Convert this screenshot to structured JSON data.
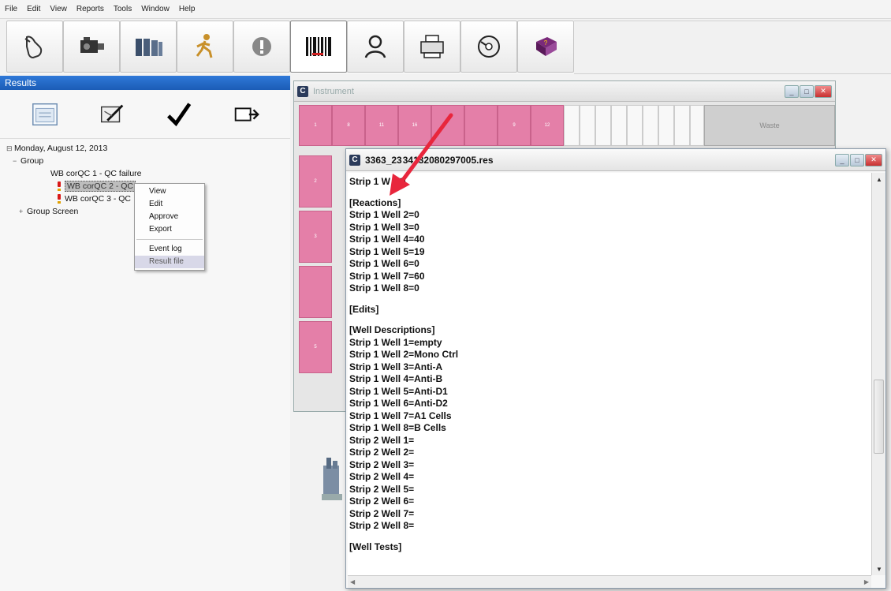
{
  "menu": [
    "File",
    "Edit",
    "View",
    "Reports",
    "Tools",
    "Window",
    "Help"
  ],
  "toolbar": {
    "icons": [
      "hand-pointer-icon",
      "camera-icon",
      "rack-icon",
      "runner-icon",
      "alert-icon",
      "barcode-icon",
      "user-search-icon",
      "printer-icon",
      "disc-icon",
      "help-book-icon"
    ]
  },
  "colors": {
    "results_header": "#1b5cb6",
    "well_pink": "#e47fa8",
    "arrow_red": "#e8263c"
  },
  "results": {
    "title": "Results",
    "tree": {
      "date": "Monday, August 12, 2013",
      "group": "Group",
      "items": [
        "WB corQC 1 - QC failure",
        "WB corQC 2 - QC",
        "WB corQC 3 - QC"
      ],
      "group_screen": "Group Screen"
    }
  },
  "context_menu": {
    "items": [
      "View",
      "Edit",
      "Approve",
      "Export"
    ],
    "items2": [
      "Event log",
      "Result file"
    ]
  },
  "instrument": {
    "title": "Instrument",
    "waste_label": "Waste",
    "top_wells": [
      "1",
      "8",
      "11",
      "16",
      "",
      "",
      "9",
      "12"
    ],
    "side_wells": [
      "2",
      "3",
      "",
      "5"
    ]
  },
  "result_window": {
    "title": "3363_23 34132080297005.res",
    "lines": [
      "Strip 1 W   =Q",
      "",
      "[Reactions]",
      "Strip 1 Well 2=0",
      "Strip 1 Well 3=0",
      "Strip 1 Well 4=40",
      "Strip 1 Well 5=19",
      "Strip 1 Well 6=0",
      "Strip 1 Well 7=60",
      "Strip 1 Well 8=0",
      "",
      "[Edits]",
      "",
      "[Well Descriptions]",
      "Strip 1 Well 1=empty",
      "Strip 1 Well 2=Mono Ctrl",
      "Strip 1 Well 3=Anti-A",
      "Strip 1 Well 4=Anti-B",
      "Strip 1 Well 5=Anti-D1",
      "Strip 1 Well 6=Anti-D2",
      "Strip 1 Well 7=A1 Cells",
      "Strip 1 Well 8=B Cells",
      "Strip 2 Well 1=",
      "Strip 2 Well 2=",
      "Strip 2 Well 3=",
      "Strip 2 Well 4=",
      "Strip 2 Well 5=",
      "Strip 2 Well 6=",
      "Strip 2 Well 7=",
      "Strip 2 Well 8=",
      "",
      "[Well Tests]"
    ]
  }
}
